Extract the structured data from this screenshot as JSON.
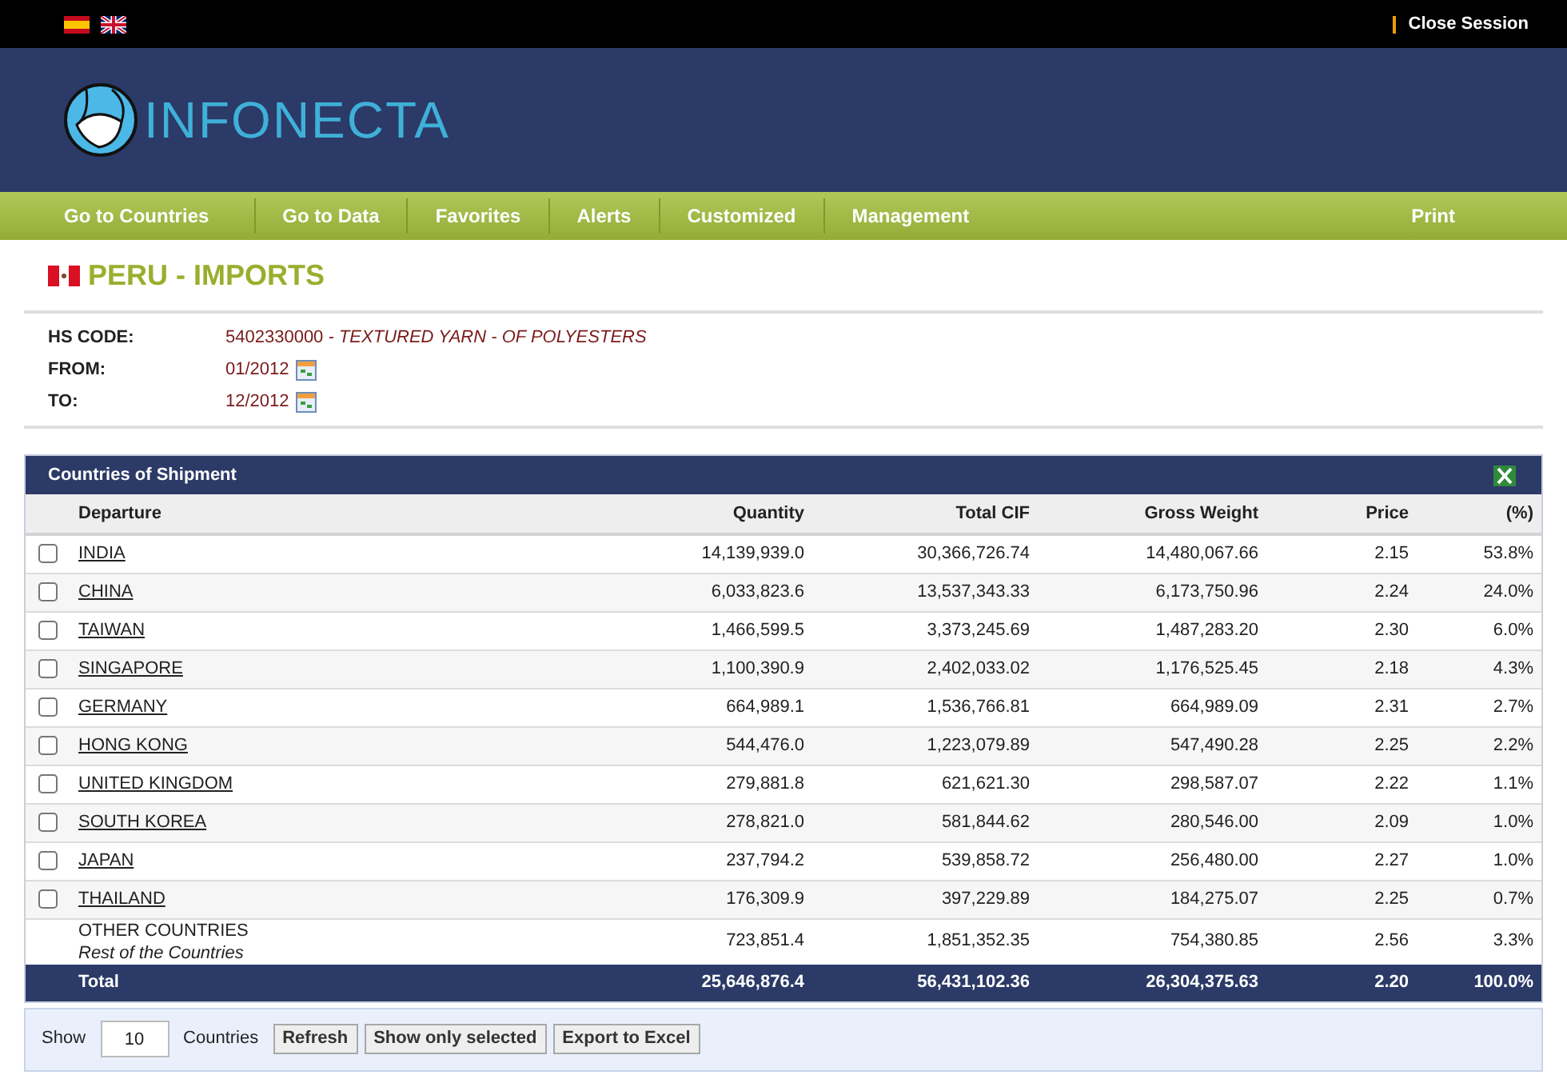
{
  "top_bar": {
    "languages": [
      {
        "kind": "es"
      },
      {
        "kind": "uk"
      }
    ],
    "close_session": "Close Session"
  },
  "logo": {
    "text": "INFONECTA"
  },
  "nav": {
    "items": [
      "Go to Countries",
      "Go to Data",
      "Favorites",
      "Alerts",
      "Customized",
      "Management"
    ],
    "print": "Print"
  },
  "title": "PERU - IMPORTS",
  "info": [
    {
      "label": "HS CODE:",
      "code": "5402330000",
      "description": " - TEXTURED YARN - OF POLYESTERS"
    },
    {
      "label": "FROM:",
      "value": "01/2012"
    },
    {
      "label": "TO:",
      "value": "12/2012"
    }
  ],
  "table": {
    "title": "Countries of Shipment",
    "columns": [
      "Departure",
      "Quantity",
      "Total CIF",
      "Gross Weight",
      "Price",
      "(%)"
    ],
    "rows": [
      {
        "selected": false,
        "cells": [
          "INDIA",
          "14,139,939.0",
          "30,366,726.74",
          "14,480,067.66",
          "2.15",
          "53.8%"
        ]
      },
      {
        "selected": false,
        "cells": [
          "CHINA",
          "6,033,823.6",
          "13,537,343.33",
          "6,173,750.96",
          "2.24",
          "24.0%"
        ]
      },
      {
        "selected": false,
        "cells": [
          "TAIWAN",
          "1,466,599.5",
          "3,373,245.69",
          "1,487,283.20",
          "2.30",
          "6.0%"
        ]
      },
      {
        "selected": false,
        "cells": [
          "SINGAPORE",
          "1,100,390.9",
          "2,402,033.02",
          "1,176,525.45",
          "2.18",
          "4.3%"
        ]
      },
      {
        "selected": false,
        "cells": [
          "GERMANY",
          "664,989.1",
          "1,536,766.81",
          "664,989.09",
          "2.31",
          "2.7%"
        ]
      },
      {
        "selected": false,
        "cells": [
          "HONG KONG",
          "544,476.0",
          "1,223,079.89",
          "547,490.28",
          "2.25",
          "2.2%"
        ]
      },
      {
        "selected": false,
        "cells": [
          "UNITED KINGDOM",
          "279,881.8",
          "621,621.30",
          "298,587.07",
          "2.22",
          "1.1%"
        ]
      },
      {
        "selected": false,
        "cells": [
          "SOUTH KOREA",
          "278,821.0",
          "581,844.62",
          "280,546.00",
          "2.09",
          "1.0%"
        ]
      },
      {
        "selected": false,
        "cells": [
          "JAPAN",
          "237,794.2",
          "539,858.72",
          "256,480.00",
          "2.27",
          "1.0%"
        ]
      },
      {
        "selected": false,
        "cells": [
          "THAILAND",
          "176,309.9",
          "397,229.89",
          "184,275.07",
          "2.25",
          "0.7%"
        ]
      }
    ],
    "other": {
      "note": "Rest of the Countries",
      "cells": [
        "OTHER COUNTRIES",
        "723,851.4",
        "1,851,352.35",
        "754,380.85",
        "2.56",
        "3.3%"
      ]
    },
    "total": {
      "cells": [
        "Total",
        "25,646,876.4",
        "56,431,102.36",
        "26,304,375.63",
        "2.20",
        "100.0%"
      ]
    }
  },
  "footer": {
    "show_label": "Show",
    "show_value": "10",
    "unit": "Countries",
    "buttons": [
      "Refresh",
      "Show only selected",
      "Export to Excel"
    ]
  }
}
